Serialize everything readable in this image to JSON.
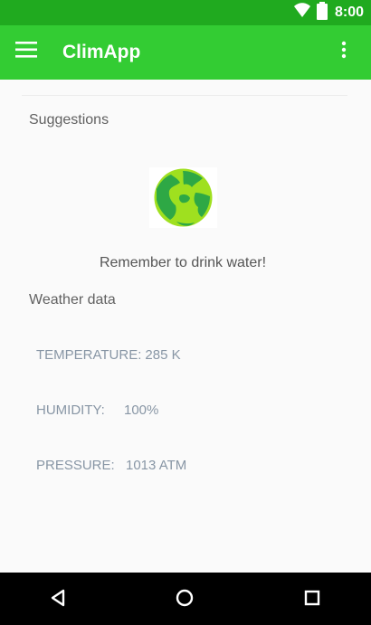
{
  "status_bar": {
    "time": "8:00",
    "icons": [
      "wifi-icon",
      "battery-icon"
    ]
  },
  "app_bar": {
    "title": "ClimApp",
    "menu_icon": "hamburger-menu-icon",
    "overflow_icon": "overflow-menu-icon"
  },
  "suggestions": {
    "heading": "Suggestions",
    "icon": "globe-icon",
    "message": "Remember to drink water!"
  },
  "weather": {
    "heading": "Weather data",
    "rows": [
      {
        "label": "TEMPERATURE:",
        "value": "285 K"
      },
      {
        "label": "HUMIDITY:",
        "value": "100%"
      },
      {
        "label": "PRESSURE:",
        "value": "1013 ATM"
      }
    ]
  },
  "navigation": {
    "icons": [
      "back-icon",
      "home-icon",
      "recents-icon"
    ]
  },
  "colors": {
    "status_bar": "#20aa1f",
    "app_bar": "#33cc33",
    "background": "#fafafa",
    "weather_text": "#8896a5",
    "navigation_bar": "#000000"
  }
}
